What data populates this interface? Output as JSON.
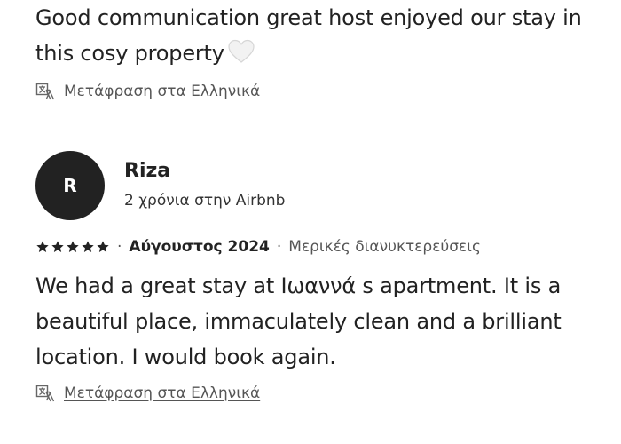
{
  "review1": {
    "text": "Good communication great host enjoyed our stay in this cosy property",
    "emoji_icon": "white-heart-icon",
    "translate_label": "Μετάφραση στα Ελληνικά"
  },
  "review2": {
    "reviewer_initial": "R",
    "reviewer_name": "Riza",
    "reviewer_tenure": "2 χρόνια στην Airbnb",
    "rating_stars": 5,
    "date": "Αύγουστος 2024",
    "stay_type": "Μερικές διανυκτερεύσεις",
    "text": "We had a great stay at Ιωαννά s apartment. It is a beautiful place, immaculately clean and a brilliant location. I would book again.",
    "translate_label": "Μετάφραση στα Ελληνικά"
  },
  "colors": {
    "text": "#222222",
    "secondary_text": "#555555",
    "avatar_bg": "#222222",
    "avatar_text": "#ffffff"
  },
  "icons": {
    "translate": "translate-icon",
    "star": "star-icon"
  }
}
